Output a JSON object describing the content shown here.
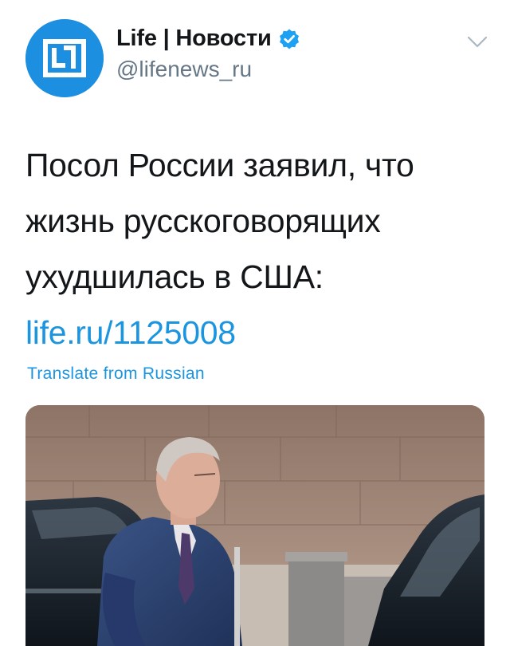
{
  "account": {
    "display_name": "Life | Новости",
    "handle": "@lifenews_ru",
    "verified": true,
    "avatar_icon": "life-logo-icon",
    "avatar_color": "#1d8fe1"
  },
  "tweet": {
    "text": "Посол России заявил, что жизнь русскоговорящих ухудшилась в США: ",
    "link_text": "life.ru/1125008",
    "translate_label": "Translate from Russian"
  },
  "icons": {
    "verified": "verified-badge-icon",
    "menu": "chevron-down-icon"
  },
  "colors": {
    "link": "#1b95e0",
    "text": "#14171a",
    "secondary": "#657786"
  },
  "media": {
    "type": "photo"
  }
}
